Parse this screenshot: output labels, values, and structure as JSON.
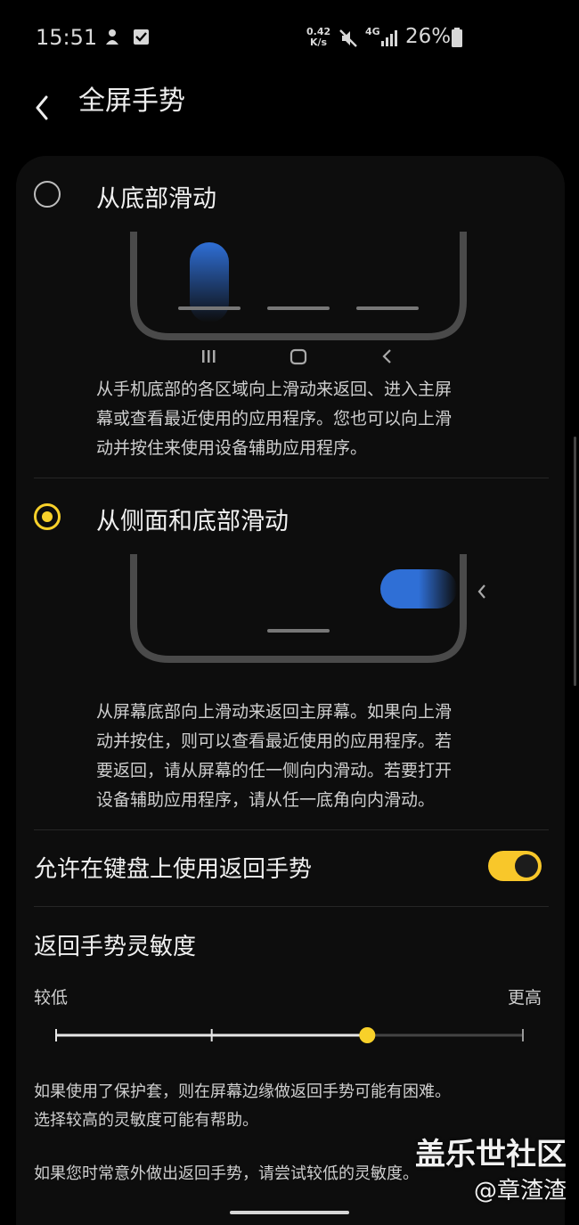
{
  "status": {
    "time": "15:51",
    "net_speed_value": "0.42",
    "net_speed_unit": "K/s",
    "network": "4G",
    "battery": "26%",
    "icons": [
      "notification-app-icon",
      "checkbox-notification-icon",
      "mute-icon",
      "signal-icon",
      "battery-icon"
    ]
  },
  "header": {
    "title": "全屏手势",
    "back_icon": "chevron-left-icon"
  },
  "options": [
    {
      "title": "从底部滑动",
      "selected": false,
      "description_lines": [
        "从手机底部的各区域向上滑动来返回、进入主屏",
        "幕或查看最近使用的应用程序。您也可以向上滑",
        "动并按住来使用设备辅助应用程序。"
      ]
    },
    {
      "title": "从侧面和底部滑动",
      "selected": true,
      "description_lines": [
        "从屏幕底部向上滑动来返回主屏幕。如果向上滑",
        "动并按住，则可以查看最近使用的应用程序。若",
        "要返回，请从屏幕的任一侧向内滑动。若要打开",
        "设备辅助应用程序，请从任一底角向内滑动。"
      ]
    }
  ],
  "keyboard_toggle": {
    "label": "允许在键盘上使用返回手势",
    "on": true
  },
  "sensitivity": {
    "title": "返回手势灵敏度",
    "low_label": "较低",
    "high_label": "更高",
    "steps": 4,
    "value_index": 2
  },
  "notes": {
    "line1": "如果使用了保护套，则在屏幕边缘做返回手势可能有困难。",
    "line2": "选择较高的灵敏度可能有帮助。",
    "line3": "如果您时常意外做出返回手势，请尝试较低的灵敏度。"
  },
  "watermark": {
    "line1": "盖乐世社区",
    "line2": "@章渣渣"
  },
  "colors": {
    "accent": "#f8d12a",
    "gesture_blue": "#2f6fd6",
    "background": "#000000"
  }
}
